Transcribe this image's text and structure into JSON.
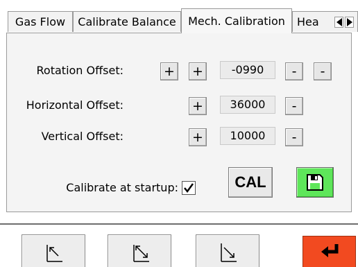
{
  "tabs": [
    {
      "label": "Gas Flow",
      "active": false
    },
    {
      "label": "Calibrate Balance",
      "active": false
    },
    {
      "label": "Mech. Calibration",
      "active": true
    },
    {
      "label": "Hea",
      "active": false
    }
  ],
  "tab_scroll": {
    "left_icon": "triangle-left-icon",
    "right_icon": "triangle-right-icon"
  },
  "rows": [
    {
      "label": "Rotation Offset:",
      "value": "-0990"
    },
    {
      "label": "Horizontal Offset:",
      "value": "36000"
    },
    {
      "label": "Vertical Offset:",
      "value": "10000"
    }
  ],
  "plus_label": "+",
  "minus_label": "-",
  "calibrate_startup": {
    "label": "Calibrate at startup:",
    "checked": true
  },
  "cal_button_label": "CAL",
  "save_button": {
    "icon": "floppy-disk-icon",
    "color": "#5ee65a"
  },
  "bottom_nav": [
    {
      "icon": "diagonal-arrow-up-left-icon"
    },
    {
      "icon": "diagonal-arrows-converge-icon"
    },
    {
      "icon": "diagonal-arrow-down-right-icon"
    }
  ],
  "enter_button": {
    "icon": "return-arrow-icon",
    "color": "#f24a20"
  }
}
